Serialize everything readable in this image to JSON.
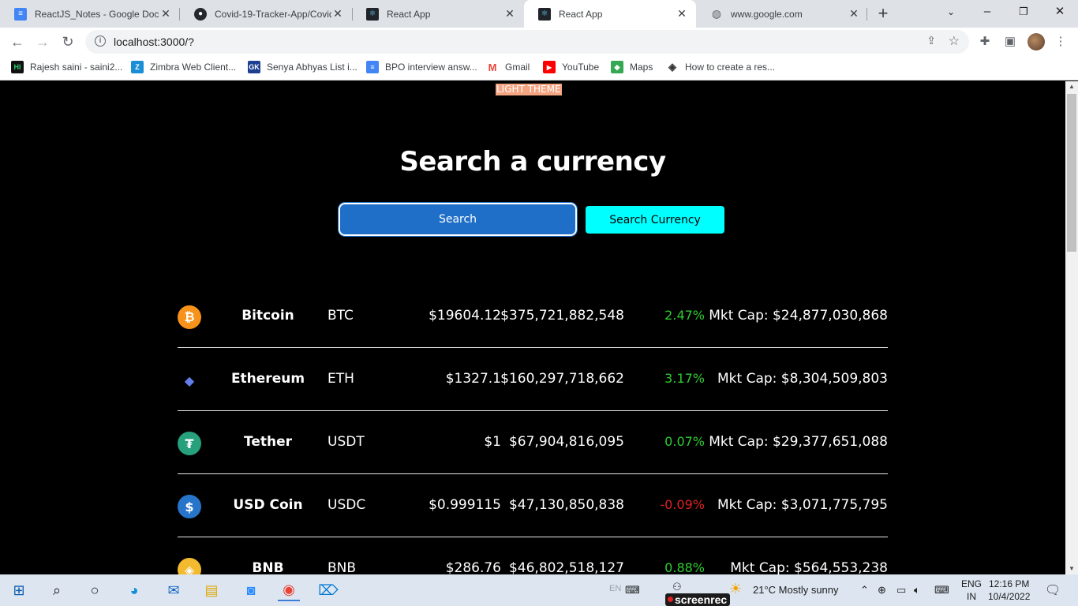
{
  "browser": {
    "tabs": [
      {
        "title": "ReactJS_Notes - Google Doc",
        "icon": "google-docs-icon"
      },
      {
        "title": "Covid-19-Tracker-App/Covid",
        "icon": "github-icon"
      },
      {
        "title": "React App",
        "icon": "react-icon"
      },
      {
        "title": "React App",
        "icon": "react-icon"
      },
      {
        "title": "www.google.com",
        "icon": "globe-icon"
      }
    ],
    "url": "localhost:3000/?",
    "bookmarks": [
      {
        "label": "Rajesh saini - saini2...",
        "icon": "hi-icon"
      },
      {
        "label": "Zimbra Web Client...",
        "icon": "zimbra-icon"
      },
      {
        "label": "Senya Abhyas List i...",
        "icon": "gk-icon"
      },
      {
        "label": "BPO interview answ...",
        "icon": "google-docs-icon"
      },
      {
        "label": "Gmail",
        "icon": "gmail-icon"
      },
      {
        "label": "YouTube",
        "icon": "youtube-icon"
      },
      {
        "label": "Maps",
        "icon": "maps-icon"
      },
      {
        "label": "How to create a res...",
        "icon": "codepen-icon"
      }
    ]
  },
  "app": {
    "theme_button": "LIGHT THEME",
    "title": "Search a currency",
    "search_placeholder": "Search",
    "search_button": "Search Currency",
    "coins": [
      {
        "name": "Bitcoin",
        "symbol": "BTC",
        "price": "$19604.12",
        "volume": "$375,721,882,548",
        "change": "2.47%",
        "mcap": "Mkt Cap: $24,877,030,868",
        "trend": "up",
        "color": "#f7931a"
      },
      {
        "name": "Ethereum",
        "symbol": "ETH",
        "price": "$1327.1",
        "volume": "$160,297,718,662",
        "change": "3.17%",
        "mcap": "Mkt Cap: $8,304,509,803",
        "trend": "up",
        "color": "#627eea"
      },
      {
        "name": "Tether",
        "symbol": "USDT",
        "price": "$1",
        "volume": "$67,904,816,095",
        "change": "0.07%",
        "mcap": "Mkt Cap: $29,377,651,088",
        "trend": "up",
        "color": "#26a17b"
      },
      {
        "name": "USD Coin",
        "symbol": "USDC",
        "price": "$0.999115",
        "volume": "$47,130,850,838",
        "change": "-0.09%",
        "mcap": "Mkt Cap: $3,071,775,795",
        "trend": "down",
        "color": "#2775ca"
      },
      {
        "name": "BNB",
        "symbol": "BNB",
        "price": "$286.76",
        "volume": "$46,802,518,127",
        "change": "0.88%",
        "mcap": "Mkt Cap: $564,553,238",
        "trend": "up",
        "color": "#f3ba2f"
      }
    ]
  },
  "taskbar": {
    "weather": "21°C  Mostly sunny",
    "lang_top": "ENG",
    "lang_bottom": "IN",
    "time": "12:16 PM",
    "date": "10/4/2022",
    "screenrec": "screenrec",
    "tray_text": "EN"
  }
}
